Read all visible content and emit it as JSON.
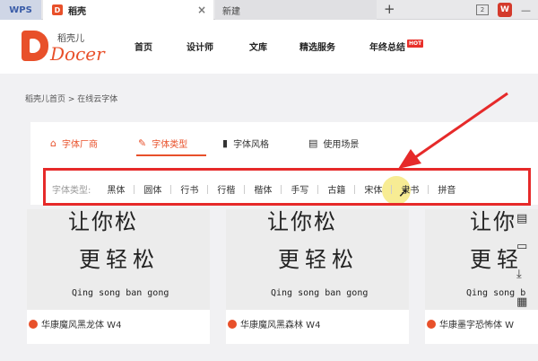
{
  "titlebar": {
    "tabs": [
      {
        "label": "WPS"
      },
      {
        "label": "稻壳"
      },
      {
        "label": "新建"
      }
    ],
    "new_tab_symbol": "+",
    "close_symbol": "×",
    "right_box_label": "2",
    "right_w_label": "W",
    "minimize_symbol": "—"
  },
  "header": {
    "logo_cn": "稻壳儿",
    "logo_en": "Docer",
    "nav": [
      "首页",
      "设计师",
      "文库",
      "精选服务",
      "年终总结"
    ],
    "hot_badge": "HOT"
  },
  "breadcrumb": "稻壳儿首页 > 在线云字体",
  "category_tabs": [
    {
      "label": "字体厂商",
      "icon": "home-icon"
    },
    {
      "label": "字体类型",
      "icon": "pen-icon"
    },
    {
      "label": "字体风格",
      "icon": "bookmark-icon"
    },
    {
      "label": "使用场景",
      "icon": "document-icon"
    }
  ],
  "filter": {
    "label": "字体类型:",
    "items": [
      "黑体",
      "圆体",
      "行书",
      "行楷",
      "楷体",
      "手写",
      "古籍",
      "宋体",
      "隶书",
      "拼音"
    ]
  },
  "font_cards": [
    {
      "preview_line1": "让你松",
      "preview_line2": "更轻松",
      "pinyin": "Qing song ban gong",
      "name": "华康魔风黑龙体 W4"
    },
    {
      "preview_line1": "让你松",
      "preview_line2": "更轻松",
      "pinyin": "Qing song ban gong",
      "name": "华康魔风黑森林 W4"
    },
    {
      "preview_line1": "让你",
      "preview_line2": "更轻",
      "pinyin": "Qing song b",
      "name": "华康墨字恐怖体 W"
    }
  ],
  "colors": {
    "accent": "#e8502a",
    "highlight_border": "#e62a2a",
    "arrow": "#e62a2a"
  }
}
